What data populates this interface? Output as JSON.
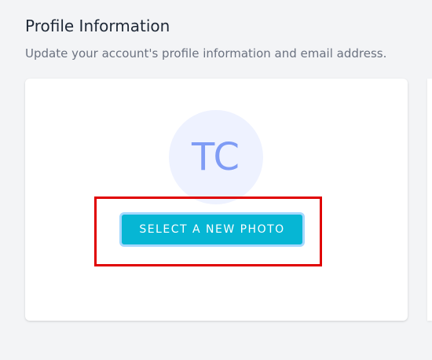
{
  "section": {
    "title": "Profile Information",
    "description": "Update your account's profile information and email address."
  },
  "profile": {
    "avatar_initials": "TC",
    "select_photo_label": "SELECT A NEW PHOTO"
  },
  "colors": {
    "button_bg": "#06b6d4",
    "avatar_bg": "#eef2ff",
    "avatar_text": "#7f9cf5",
    "highlight": "#e00000"
  }
}
